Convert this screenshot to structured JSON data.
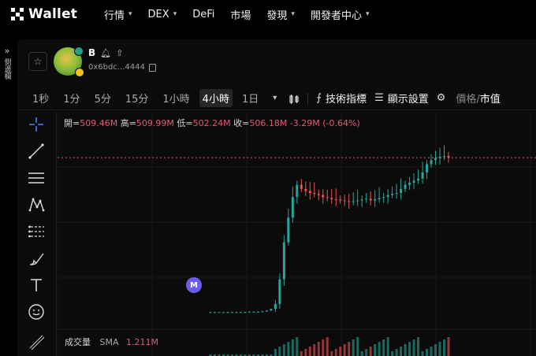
{
  "brand": {
    "name": "Wallet"
  },
  "nav": [
    {
      "label": "行情",
      "dropdown": true
    },
    {
      "label": "DEX",
      "dropdown": true
    },
    {
      "label": "DeFi",
      "dropdown": false
    },
    {
      "label": "市場",
      "dropdown": false
    },
    {
      "label": "發現",
      "dropdown": true
    },
    {
      "label": "開發者中心",
      "dropdown": true
    }
  ],
  "leftrail": {
    "label": "側邊欄"
  },
  "token": {
    "name": "B",
    "address": "0x6bdc...4444"
  },
  "toolbar": {
    "timeframes": [
      "1秒",
      "1分",
      "5分",
      "15分",
      "1小時",
      "4小時",
      "1日"
    ],
    "active_timeframe": "4小時",
    "indicators_label": "技術指標",
    "display_settings_label": "顯示設置",
    "price_label": "價格",
    "divider": "/",
    "mcap_label": "市值"
  },
  "ohlc": {
    "open_label": "開=",
    "open": "509.46M",
    "high_label": "高=",
    "high": "509.99M",
    "low_label": "低=",
    "low": "502.24M",
    "close_label": "收=",
    "close": "506.18M",
    "change": "-3.29M (-0.64%)"
  },
  "volume": {
    "label": "成交量",
    "sma_label": "SMA",
    "sma_value": "1.211M"
  },
  "marker": {
    "label": "M"
  },
  "colors": {
    "up": "#26a69a",
    "down": "#ef5350",
    "accent_red": "#e05a7a",
    "marker": "#6a5cf0"
  },
  "chart_data": {
    "type": "candlestick",
    "unit": "market cap (M)",
    "series": [
      {
        "close": [
          130,
          130,
          130,
          130,
          130,
          130,
          130,
          130,
          130,
          131,
          131,
          131,
          132,
          134,
          138,
          150,
          210,
          300,
          360,
          410,
          440,
          430,
          425,
          420,
          418,
          415,
          410,
          408,
          405,
          404,
          402,
          400,
          398,
          400,
          402,
          404,
          406,
          402,
          405,
          408,
          410,
          415,
          418,
          420,
          430,
          440,
          445,
          450,
          455,
          470,
          490,
          500,
          505,
          508,
          510,
          506
        ]
      }
    ],
    "last_value": 506.18
  }
}
